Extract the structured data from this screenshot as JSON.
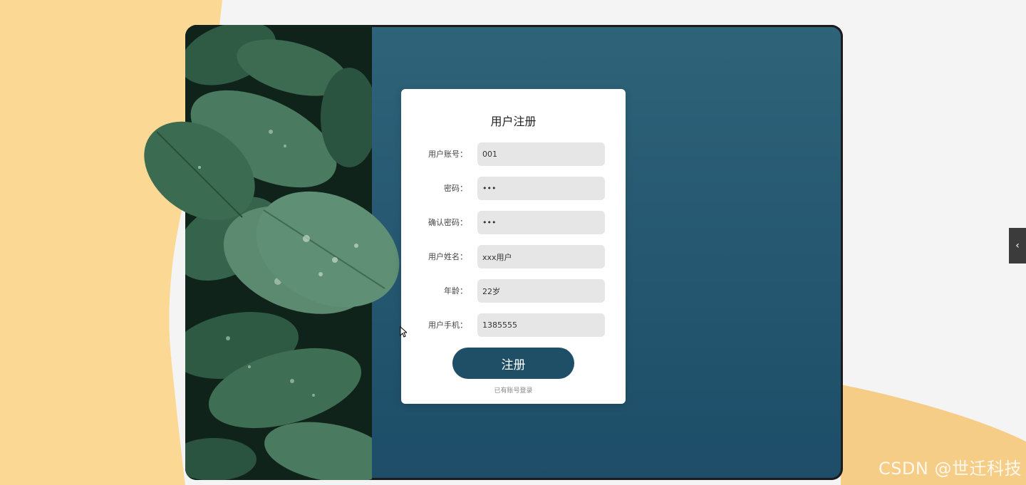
{
  "form": {
    "title": "用户注册",
    "fields": [
      {
        "label": "用户账号：",
        "value": "001",
        "type": "text"
      },
      {
        "label": "密码：",
        "value": "•••",
        "type": "password"
      },
      {
        "label": "确认密码：",
        "value": "•••",
        "type": "password"
      },
      {
        "label": "用户姓名：",
        "value": "xxx用户",
        "type": "text"
      },
      {
        "label": "年龄：",
        "value": "22岁",
        "type": "text"
      },
      {
        "label": "用户手机：",
        "value": "1385555",
        "type": "text"
      }
    ],
    "submit_label": "注册",
    "login_link": "已有账号登录"
  },
  "side_toggle": {
    "icon": "chevron-left-icon",
    "glyph": "‹"
  },
  "watermark": "CSDN @世迁科技",
  "colors": {
    "panel": "#1e4f66",
    "button": "#1e4f66",
    "background_accent": "#f8d38e"
  }
}
